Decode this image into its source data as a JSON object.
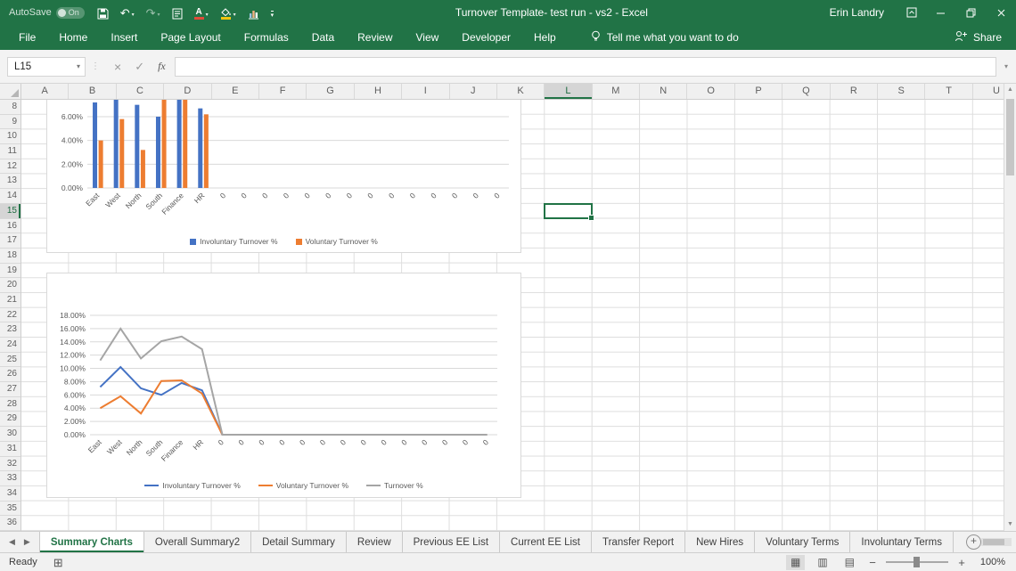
{
  "colors": {
    "excel_green": "#217346",
    "series_blue": "#4472C4",
    "series_orange": "#ED7D31",
    "series_gray": "#A5A5A5",
    "font_color_red": "#E04B3A",
    "fill_color_yellow": "#F2C50E"
  },
  "title_bar": {
    "autosave_label": "AutoSave",
    "autosave_state": "On",
    "title": "Turnover Template- test run - vs2 -  Excel",
    "user": "Erin Landry"
  },
  "ribbon": {
    "tabs": [
      "File",
      "Home",
      "Insert",
      "Page Layout",
      "Formulas",
      "Data",
      "Review",
      "View",
      "Developer",
      "Help"
    ],
    "tell_me": "Tell me what you want to do",
    "share": "Share"
  },
  "formula_bar": {
    "name_box": "L15",
    "formula": ""
  },
  "worksheet": {
    "columns": [
      "A",
      "B",
      "C",
      "D",
      "E",
      "F",
      "G",
      "H",
      "I",
      "J",
      "K",
      "L",
      "M",
      "N",
      "O",
      "P",
      "Q",
      "R",
      "S",
      "T",
      "U"
    ],
    "first_row": 8,
    "last_row": 36,
    "selected_cell": "L15",
    "selected_column": "L",
    "selected_row": 15
  },
  "chart_data": [
    {
      "type": "bar",
      "title": "",
      "xlabel": "",
      "ylabel": "",
      "categories": [
        "East",
        "West",
        "North",
        "South",
        "Finance",
        "HR",
        "0",
        "0",
        "0",
        "0",
        "0",
        "0",
        "0",
        "0",
        "0",
        "0",
        "0",
        "0",
        "0",
        "0"
      ],
      "series": [
        {
          "name": "Involuntary Turnover %",
          "color": "#4472C4",
          "values": [
            7.2,
            10.2,
            7.0,
            6.0,
            7.8,
            6.7,
            0,
            0,
            0,
            0,
            0,
            0,
            0,
            0,
            0,
            0,
            0,
            0,
            0,
            0
          ]
        },
        {
          "name": "Voluntary Turnover %",
          "color": "#ED7D31",
          "values": [
            4.0,
            5.8,
            3.2,
            8.1,
            8.2,
            6.2,
            0,
            0,
            0,
            0,
            0,
            0,
            0,
            0,
            0,
            0,
            0,
            0,
            0,
            0
          ]
        }
      ],
      "yticks": [
        0,
        2,
        4,
        6
      ],
      "ytick_format": "percent",
      "visible_ylim": [
        0,
        6.9
      ],
      "grid": true,
      "legend_position": "bottom"
    },
    {
      "type": "line",
      "title": "",
      "xlabel": "",
      "ylabel": "",
      "categories": [
        "East",
        "West",
        "North",
        "South",
        "Finance",
        "HR",
        "0",
        "0",
        "0",
        "0",
        "0",
        "0",
        "0",
        "0",
        "0",
        "0",
        "0",
        "0",
        "0",
        "0"
      ],
      "series": [
        {
          "name": "Involuntary Turnover %",
          "color": "#4472C4",
          "values": [
            7.2,
            10.2,
            7.0,
            6.0,
            7.8,
            6.7,
            0,
            0,
            0,
            0,
            0,
            0,
            0,
            0,
            0,
            0,
            0,
            0,
            0,
            0
          ]
        },
        {
          "name": "Voluntary Turnover %",
          "color": "#ED7D31",
          "values": [
            4.0,
            5.8,
            3.2,
            8.1,
            8.2,
            6.2,
            0,
            0,
            0,
            0,
            0,
            0,
            0,
            0,
            0,
            0,
            0,
            0,
            0,
            0
          ]
        },
        {
          "name": "Turnover %",
          "color": "#A5A5A5",
          "values": [
            11.2,
            16.0,
            11.5,
            14.1,
            14.8,
            12.9,
            0,
            0,
            0,
            0,
            0,
            0,
            0,
            0,
            0,
            0,
            0,
            0,
            0,
            0
          ]
        }
      ],
      "yticks": [
        0,
        2,
        4,
        6,
        8,
        10,
        12,
        14,
        16,
        18
      ],
      "ytick_format": "percent",
      "ylim": [
        0,
        18
      ],
      "grid": true,
      "legend_position": "bottom"
    }
  ],
  "sheet_tabs": {
    "active": "Summary Charts",
    "items": [
      "Summary Charts",
      "Overall Summary2",
      "Detail Summary",
      "Review",
      "Previous EE List",
      "Current EE List",
      "Transfer Report",
      "New Hires",
      "Voluntary Terms",
      "Involuntary Terms"
    ]
  },
  "status_bar": {
    "mode": "Ready",
    "zoom_level": "100%"
  }
}
